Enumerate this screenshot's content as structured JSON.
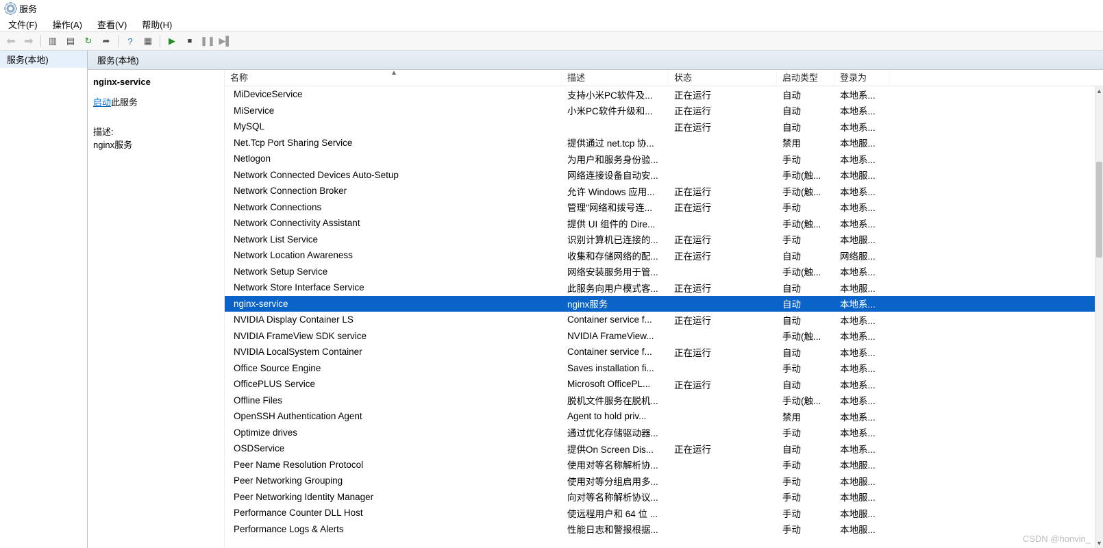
{
  "window": {
    "title": "服务"
  },
  "menu": {
    "file": "文件(F)",
    "action": "操作(A)",
    "view": "查看(V)",
    "help": "帮助(H)"
  },
  "tree": {
    "root": "服务(本地)"
  },
  "pane_header": "服务(本地)",
  "selected_detail": {
    "name": "nginx-service",
    "start_link": "启动",
    "start_suffix": "此服务",
    "desc_label": "描述:",
    "desc_value": "nginx服务"
  },
  "columns": {
    "name": "名称",
    "desc": "描述",
    "status": "状态",
    "startup": "启动类型",
    "logon": "登录为"
  },
  "services": [
    {
      "name": "MiDeviceService",
      "desc": "支持小米PC软件及...",
      "status": "正在运行",
      "startup": "自动",
      "logon": "本地系..."
    },
    {
      "name": "MiService",
      "desc": "小米PC软件升级和...",
      "status": "正在运行",
      "startup": "自动",
      "logon": "本地系..."
    },
    {
      "name": "MySQL",
      "desc": "",
      "status": "正在运行",
      "startup": "自动",
      "logon": "本地系..."
    },
    {
      "name": "Net.Tcp Port Sharing Service",
      "desc": "提供通过 net.tcp 协...",
      "status": "",
      "startup": "禁用",
      "logon": "本地服..."
    },
    {
      "name": "Netlogon",
      "desc": "为用户和服务身份验...",
      "status": "",
      "startup": "手动",
      "logon": "本地系..."
    },
    {
      "name": "Network Connected Devices Auto-Setup",
      "desc": "网络连接设备自动安...",
      "status": "",
      "startup": "手动(触...",
      "logon": "本地服..."
    },
    {
      "name": "Network Connection Broker",
      "desc": "允许 Windows 应用...",
      "status": "正在运行",
      "startup": "手动(触...",
      "logon": "本地系..."
    },
    {
      "name": "Network Connections",
      "desc": "管理\"网络和拨号连...",
      "status": "正在运行",
      "startup": "手动",
      "logon": "本地系..."
    },
    {
      "name": "Network Connectivity Assistant",
      "desc": "提供 UI 组件的 Dire...",
      "status": "",
      "startup": "手动(触...",
      "logon": "本地系..."
    },
    {
      "name": "Network List Service",
      "desc": "识别计算机已连接的...",
      "status": "正在运行",
      "startup": "手动",
      "logon": "本地服..."
    },
    {
      "name": "Network Location Awareness",
      "desc": "收集和存储网络的配...",
      "status": "正在运行",
      "startup": "自动",
      "logon": "网络服..."
    },
    {
      "name": "Network Setup Service",
      "desc": "网络安装服务用于管...",
      "status": "",
      "startup": "手动(触...",
      "logon": "本地系..."
    },
    {
      "name": "Network Store Interface Service",
      "desc": "此服务向用户模式客...",
      "status": "正在运行",
      "startup": "自动",
      "logon": "本地服..."
    },
    {
      "name": "nginx-service",
      "desc": "nginx服务",
      "status": "",
      "startup": "自动",
      "logon": "本地系...",
      "selected": true
    },
    {
      "name": "NVIDIA Display Container LS",
      "desc": "Container service f...",
      "status": "正在运行",
      "startup": "自动",
      "logon": "本地系..."
    },
    {
      "name": "NVIDIA FrameView SDK service",
      "desc": "NVIDIA FrameView...",
      "status": "",
      "startup": "手动(触...",
      "logon": "本地系..."
    },
    {
      "name": "NVIDIA LocalSystem Container",
      "desc": "Container service f...",
      "status": "正在运行",
      "startup": "自动",
      "logon": "本地系..."
    },
    {
      "name": "Office  Source Engine",
      "desc": "Saves installation fi...",
      "status": "",
      "startup": "手动",
      "logon": "本地系..."
    },
    {
      "name": "OfficePLUS Service",
      "desc": "Microsoft OfficePL...",
      "status": "正在运行",
      "startup": "自动",
      "logon": "本地系..."
    },
    {
      "name": "Offline Files",
      "desc": "脱机文件服务在脱机...",
      "status": "",
      "startup": "手动(触...",
      "logon": "本地系..."
    },
    {
      "name": "OpenSSH Authentication Agent",
      "desc": "Agent to hold priv...",
      "status": "",
      "startup": "禁用",
      "logon": "本地系..."
    },
    {
      "name": "Optimize drives",
      "desc": "通过优化存储驱动器...",
      "status": "",
      "startup": "手动",
      "logon": "本地系..."
    },
    {
      "name": "OSDService",
      "desc": "提供On Screen Dis...",
      "status": "正在运行",
      "startup": "自动",
      "logon": "本地系..."
    },
    {
      "name": "Peer Name Resolution Protocol",
      "desc": "使用对等名称解析协...",
      "status": "",
      "startup": "手动",
      "logon": "本地服..."
    },
    {
      "name": "Peer Networking Grouping",
      "desc": "使用对等分组启用多...",
      "status": "",
      "startup": "手动",
      "logon": "本地服..."
    },
    {
      "name": "Peer Networking Identity Manager",
      "desc": "向对等名称解析协议...",
      "status": "",
      "startup": "手动",
      "logon": "本地服..."
    },
    {
      "name": "Performance Counter DLL Host",
      "desc": "使远程用户和 64 位 ...",
      "status": "",
      "startup": "手动",
      "logon": "本地服..."
    },
    {
      "name": "Performance Logs & Alerts",
      "desc": "性能日志和警报根据...",
      "status": "",
      "startup": "手动",
      "logon": "本地服..."
    }
  ],
  "watermark": "CSDN @honvin_"
}
